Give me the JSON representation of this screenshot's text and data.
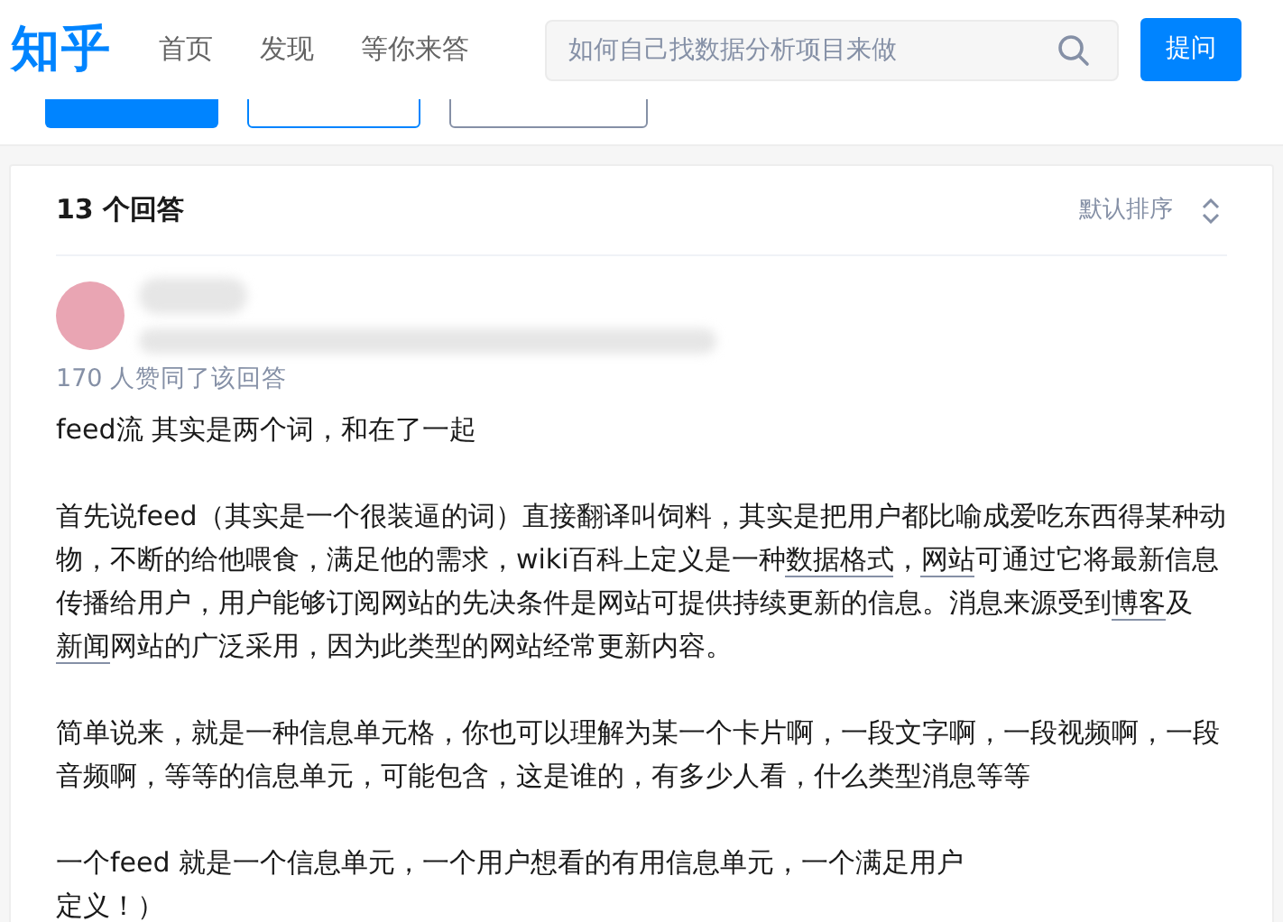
{
  "header": {
    "logo": "知乎",
    "nav": [
      {
        "label": "首页",
        "selected": false
      },
      {
        "label": "发现",
        "selected": false
      },
      {
        "label": "等你来答",
        "selected": false
      }
    ],
    "search": {
      "placeholder": "如何自己找数据分析项目来做"
    },
    "ask_button": "提问"
  },
  "answers": {
    "count_title": "13 个回答",
    "sort": "默认排序",
    "answer": {
      "votes": "170 人赞同了该回答",
      "paragraphs": [
        {
          "lines": [
            [
              {
                "text": "feed流 其实是两个词，和在了一起"
              }
            ]
          ]
        },
        {
          "lines": [
            [
              {
                "text": "首先说feed（其实是一个很装逼的词）直接翻译叫饲料，其实是把用户都比喻成爱吃东西得某种动物，不断的给他喂食，满足他的需求，wiki百科上定义是一种"
              },
              {
                "text": "数据格式",
                "link": true
              },
              {
                "text": "，"
              },
              {
                "text": "网站",
                "link": true
              },
              {
                "text": "可通过它将最新信息传播给用户，用户能够订阅网站的先决条件是网站可提供持续更新的信息。消息来源受到"
              },
              {
                "text": "博客",
                "link": true
              },
              {
                "text": "及"
              },
              {
                "text": "新闻",
                "link": true
              },
              {
                "text": "网站的广泛采用，因为此类型的网站经常更新内容。"
              }
            ]
          ]
        },
        {
          "lines": [
            [
              {
                "text": "简单说来，就是一种信息单元格，你也可以理解为某一个卡片啊，一段文字啊，一段视频啊，一段音频啊，等等的信息单元，可能包含，这是谁的，有多少人看，什么类型消息等等"
              }
            ]
          ]
        },
        {
          "lines": [
            [
              {
                "text": "一个feed 就是一个信息单元，一个用户想看的有用信息单元，一个满足用户"
              }
            ],
            [
              {
                "text": "定义！）"
              }
            ]
          ]
        }
      ]
    }
  }
}
